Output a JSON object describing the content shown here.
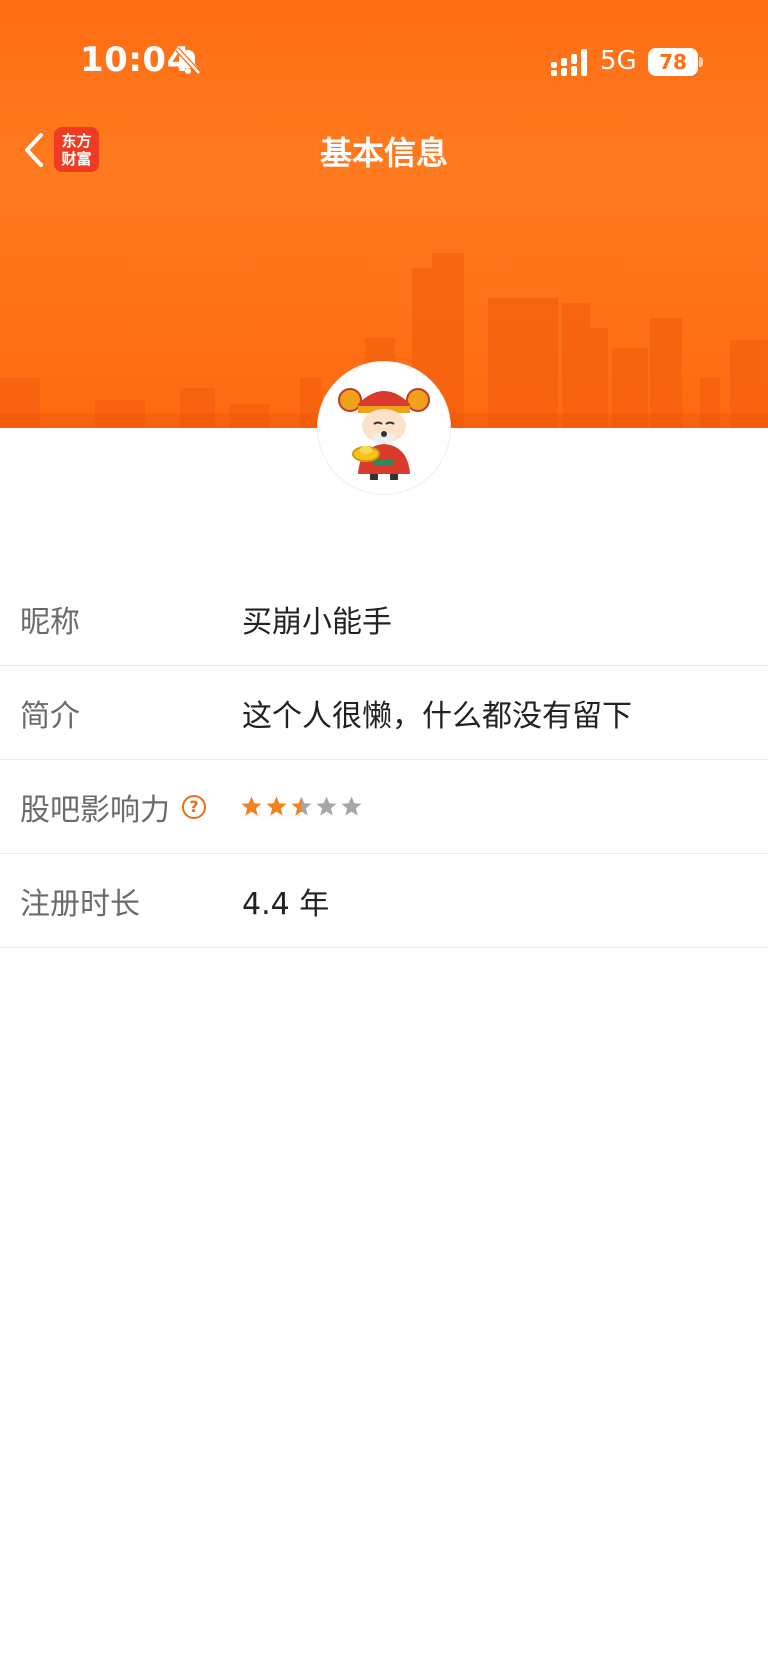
{
  "status_bar": {
    "time": "10:04",
    "network": "5G",
    "battery": "78",
    "icons": [
      "bell-muted-icon",
      "signal-icon",
      "battery-icon"
    ]
  },
  "nav": {
    "title": "基本信息",
    "logo_line1": "东方",
    "logo_line2": "财富",
    "back_icon": "chevron-left-icon"
  },
  "profile": {
    "avatar_icon": "caishen-avatar-icon",
    "rows": [
      {
        "label": "昵称",
        "value": "买崩小能手"
      },
      {
        "label": "简介",
        "value": "这个人很懒，什么都没有留下"
      },
      {
        "label": "股吧影响力",
        "help": "?",
        "rating": 2.5,
        "max_rating": 5
      },
      {
        "label": "注册时长",
        "value": "4.4 年"
      }
    ]
  },
  "colors": {
    "brand_orange": "#ff6d14",
    "logo_red": "#ee3b21",
    "star_active": "#f58220",
    "star_inactive": "#a6a6a6"
  }
}
